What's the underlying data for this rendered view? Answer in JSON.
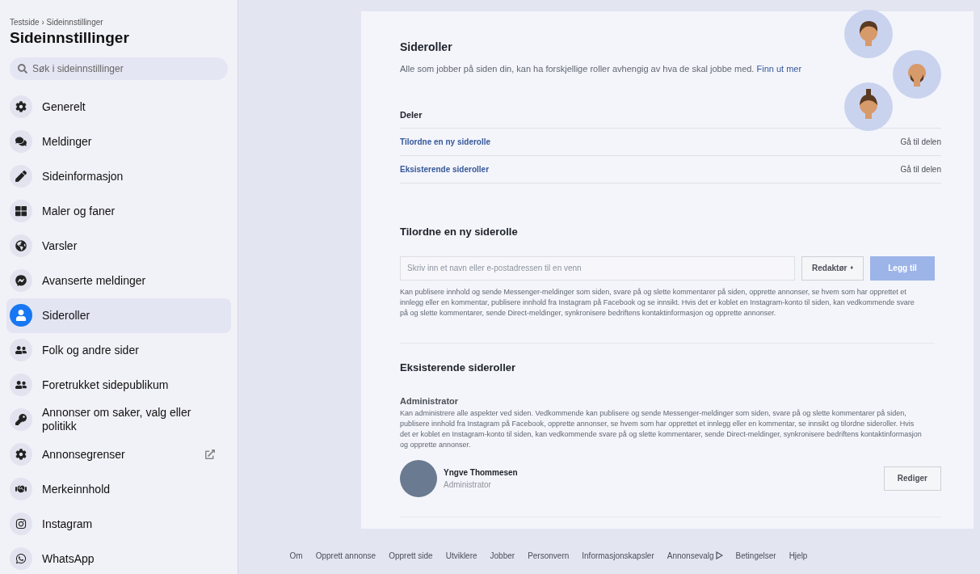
{
  "sidebar": {
    "breadcrumb": "Testside › Sideinnstillinger",
    "title": "Sideinnstillinger",
    "search": {
      "placeholder": "Søk i sideinnstillinger"
    },
    "items": [
      {
        "label": "Generelt",
        "selected": false,
        "external": false
      },
      {
        "label": "Meldinger",
        "selected": false,
        "external": false
      },
      {
        "label": "Sideinformasjon",
        "selected": false,
        "external": false
      },
      {
        "label": "Maler og faner",
        "selected": false,
        "external": false
      },
      {
        "label": "Varsler",
        "selected": false,
        "external": false
      },
      {
        "label": "Avanserte meldinger",
        "selected": false,
        "external": false
      },
      {
        "label": "Sideroller",
        "selected": true,
        "external": false
      },
      {
        "label": "Folk og andre sider",
        "selected": false,
        "external": false
      },
      {
        "label": "Foretrukket sidepublikum",
        "selected": false,
        "external": false
      },
      {
        "label": "Annonser om saker, valg eller politikk",
        "selected": false,
        "external": false
      },
      {
        "label": "Annonsegrenser",
        "selected": false,
        "external": true
      },
      {
        "label": "Merkeinnhold",
        "selected": false,
        "external": false
      },
      {
        "label": "Instagram",
        "selected": false,
        "external": false
      },
      {
        "label": "WhatsApp",
        "selected": false,
        "external": false
      }
    ]
  },
  "main": {
    "title": "Sideroller",
    "description": "Alle som jobber på siden din, kan ha forskjellige roller avhengig av hva de skal jobbe med.",
    "learn_more": "Finn ut mer",
    "sections": {
      "title": "Deler",
      "rows": [
        {
          "label": "Tilordne en ny siderolle",
          "action": "Gå til delen"
        },
        {
          "label": "Eksisterende sideroller",
          "action": "Gå til delen"
        }
      ]
    },
    "assign": {
      "title": "Tilordne en ny siderolle",
      "placeholder": "Skriv inn et navn eller e-postadressen til en venn",
      "role": "Redaktør",
      "role_caret": "♦",
      "add": "Legg til",
      "add_disabled": true,
      "description": "Kan publisere innhold og sende Messenger-meldinger som siden, svare på og slette kommentarer på siden, opprette annonser, se hvem som har opprettet et innlegg eller en kommentar, publisere innhold fra Instagram på Facebook og se innsikt. Hvis det er koblet en Instagram-konto til siden, kan vedkommende svare på og slette kommentarer, sende Direct-meldinger, synkronisere bedriftens kontaktinformasjon og opprette annonser."
    },
    "existing": {
      "title": "Eksisterende sideroller",
      "role_title": "Administrator",
      "role_description": "Kan administrere alle aspekter ved siden. Vedkommende kan publisere og sende Messenger-meldinger som siden, svare på og slette kommentarer på siden, publisere innhold fra Instagram på Facebook, opprette annonser, se hvem som har opprettet et innlegg eller en kommentar, se innsikt og tilordne sideroller. Hvis det er koblet en Instagram-konto til siden, kan vedkommende svare på og slette kommentarer, sende Direct-meldinger, synkronisere bedriftens kontaktinformasjon og opprette annonser.",
      "people": [
        {
          "name": "Yngve Thommesen",
          "role": "Administrator",
          "action": "Rediger"
        }
      ]
    }
  },
  "footer": [
    "Om",
    "Opprett annonse",
    "Opprett side",
    "Utviklere",
    "Jobber",
    "Personvern",
    "Informasjonskapsler",
    "Annonsevalg",
    "Betingelser",
    "Hjelp"
  ]
}
